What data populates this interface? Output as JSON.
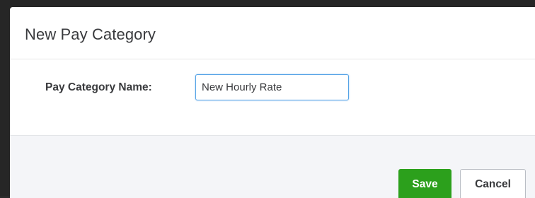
{
  "dialog": {
    "title": "New Pay Category"
  },
  "form": {
    "pay_category_label": "Pay Category Name:",
    "pay_category_value": "New Hourly Rate"
  },
  "footer": {
    "save_label": "Save",
    "cancel_label": "Cancel"
  },
  "colors": {
    "save_button": "#2ca01c",
    "input_focus_border": "#55a3e6",
    "footer_background": "#f4f5f8"
  }
}
